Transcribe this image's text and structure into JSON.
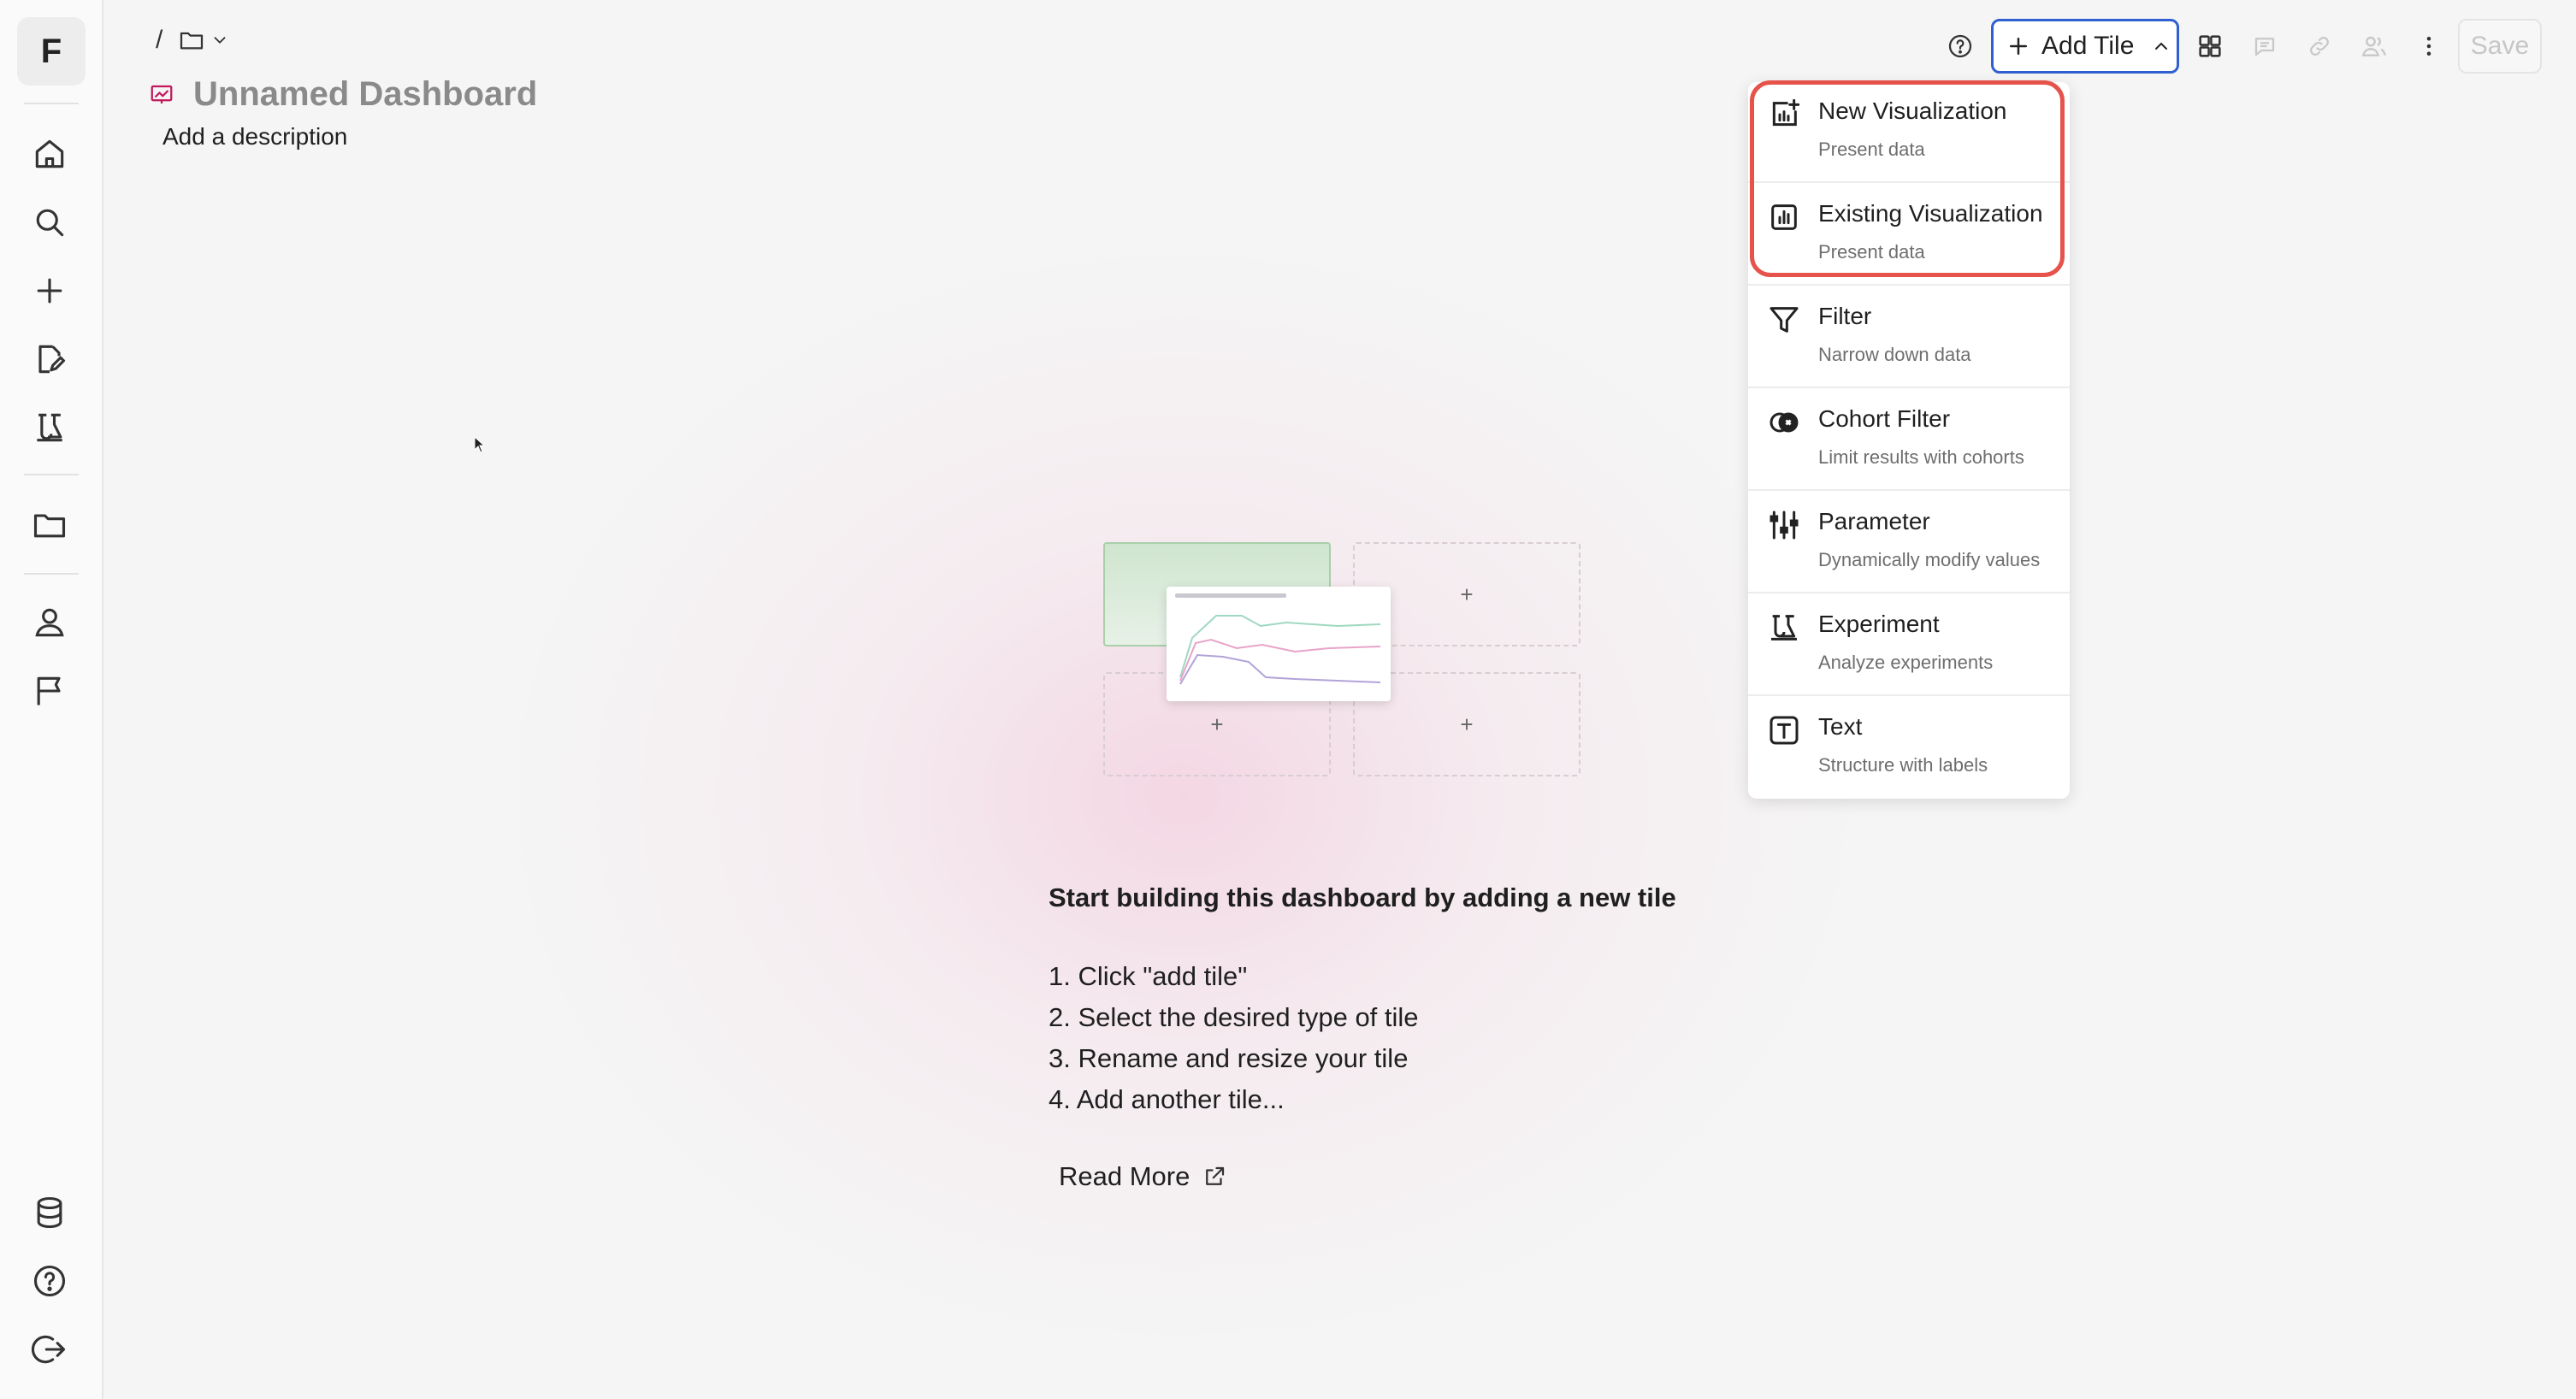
{
  "sidebar": {
    "logo": "F",
    "items": [
      {
        "icon": "home-icon"
      },
      {
        "icon": "search-icon"
      },
      {
        "icon": "plus-icon"
      },
      {
        "icon": "edit-document-icon"
      },
      {
        "icon": "experiment-icon"
      },
      {
        "icon": "folder-icon"
      },
      {
        "icon": "user-icon"
      },
      {
        "icon": "flag-icon"
      },
      {
        "icon": "database-icon"
      },
      {
        "icon": "help-icon"
      },
      {
        "icon": "logout-icon"
      }
    ]
  },
  "breadcrumb": {
    "separator": "/"
  },
  "dashboard": {
    "title": "Unnamed Dashboard",
    "description": "Add a description"
  },
  "toolbar": {
    "add_tile_label": "Add Tile",
    "save_label": "Save"
  },
  "add_tile_menu": {
    "items": [
      {
        "title": "New Visualization",
        "subtitle": "Present data",
        "icon": "new-visualization-icon"
      },
      {
        "title": "Existing Visualization",
        "subtitle": "Present data",
        "icon": "existing-visualization-icon"
      },
      {
        "title": "Filter",
        "subtitle": "Narrow down data",
        "icon": "filter-icon"
      },
      {
        "title": "Cohort Filter",
        "subtitle": "Limit results with cohorts",
        "icon": "cohort-filter-icon"
      },
      {
        "title": "Parameter",
        "subtitle": "Dynamically modify values",
        "icon": "parameter-icon"
      },
      {
        "title": "Experiment",
        "subtitle": "Analyze experiments",
        "icon": "experiment-icon"
      },
      {
        "title": "Text",
        "subtitle": "Structure with labels",
        "icon": "text-icon"
      }
    ]
  },
  "empty_state": {
    "heading": "Start building this dashboard by adding a new tile",
    "steps": [
      "1. Click \"add tile\"",
      "2. Select the desired type of tile",
      "3. Rename and resize your tile",
      "4. Add another tile..."
    ],
    "read_more": "Read More",
    "slot_plus": "+"
  },
  "colors": {
    "accent": "#2f5fd0",
    "highlight": "#e5534b",
    "dashboard_icon": "#c2185b"
  }
}
